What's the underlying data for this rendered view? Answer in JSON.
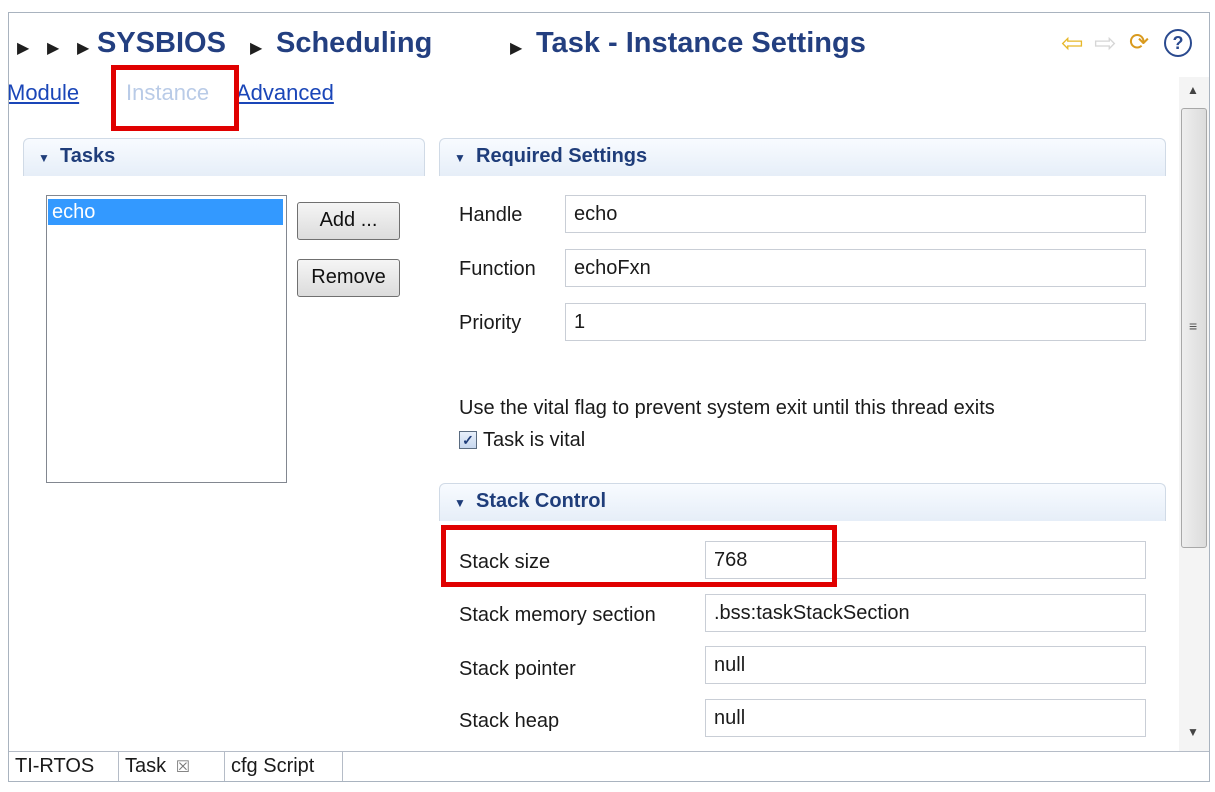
{
  "header": {
    "breadcrumb": [
      "SYSBIOS",
      "Scheduling",
      "Task - Instance Settings"
    ],
    "icons": [
      "back-arrow-icon",
      "forward-arrow-icon",
      "refresh-icon",
      "help-icon"
    ],
    "help_glyph": "?"
  },
  "subnav": {
    "module": "Module",
    "instance": "Instance",
    "advanced": "Advanced"
  },
  "tasks_section": {
    "title": "Tasks",
    "items": [
      "echo"
    ],
    "add_button": "Add ...",
    "remove_button": "Remove"
  },
  "required_settings": {
    "title": "Required Settings",
    "handle_label": "Handle",
    "handle_value": "echo",
    "function_label": "Function",
    "function_value": "echoFxn",
    "priority_label": "Priority",
    "priority_value": "1",
    "vital_note": "Use the vital flag to prevent system exit until this thread exits",
    "vital_checkbox_label": "Task is vital",
    "vital_checked": true
  },
  "stack_control": {
    "title": "Stack Control",
    "stack_size_label": "Stack size",
    "stack_size_value": "768",
    "stack_memory_section_label": "Stack memory section",
    "stack_memory_section_value": ".bss:taskStackSection",
    "stack_pointer_label": "Stack pointer",
    "stack_pointer_value": "null",
    "stack_heap_label": "Stack heap",
    "stack_heap_value": "null"
  },
  "tabs": {
    "tirtos": "TI-RTOS",
    "task": "Task",
    "task_close": "☒",
    "cfg_script": "cfg Script"
  },
  "colors": {
    "highlight": "#e00000",
    "title": "#233f80",
    "selection": "#3399ff",
    "link": "#1a46b8"
  }
}
